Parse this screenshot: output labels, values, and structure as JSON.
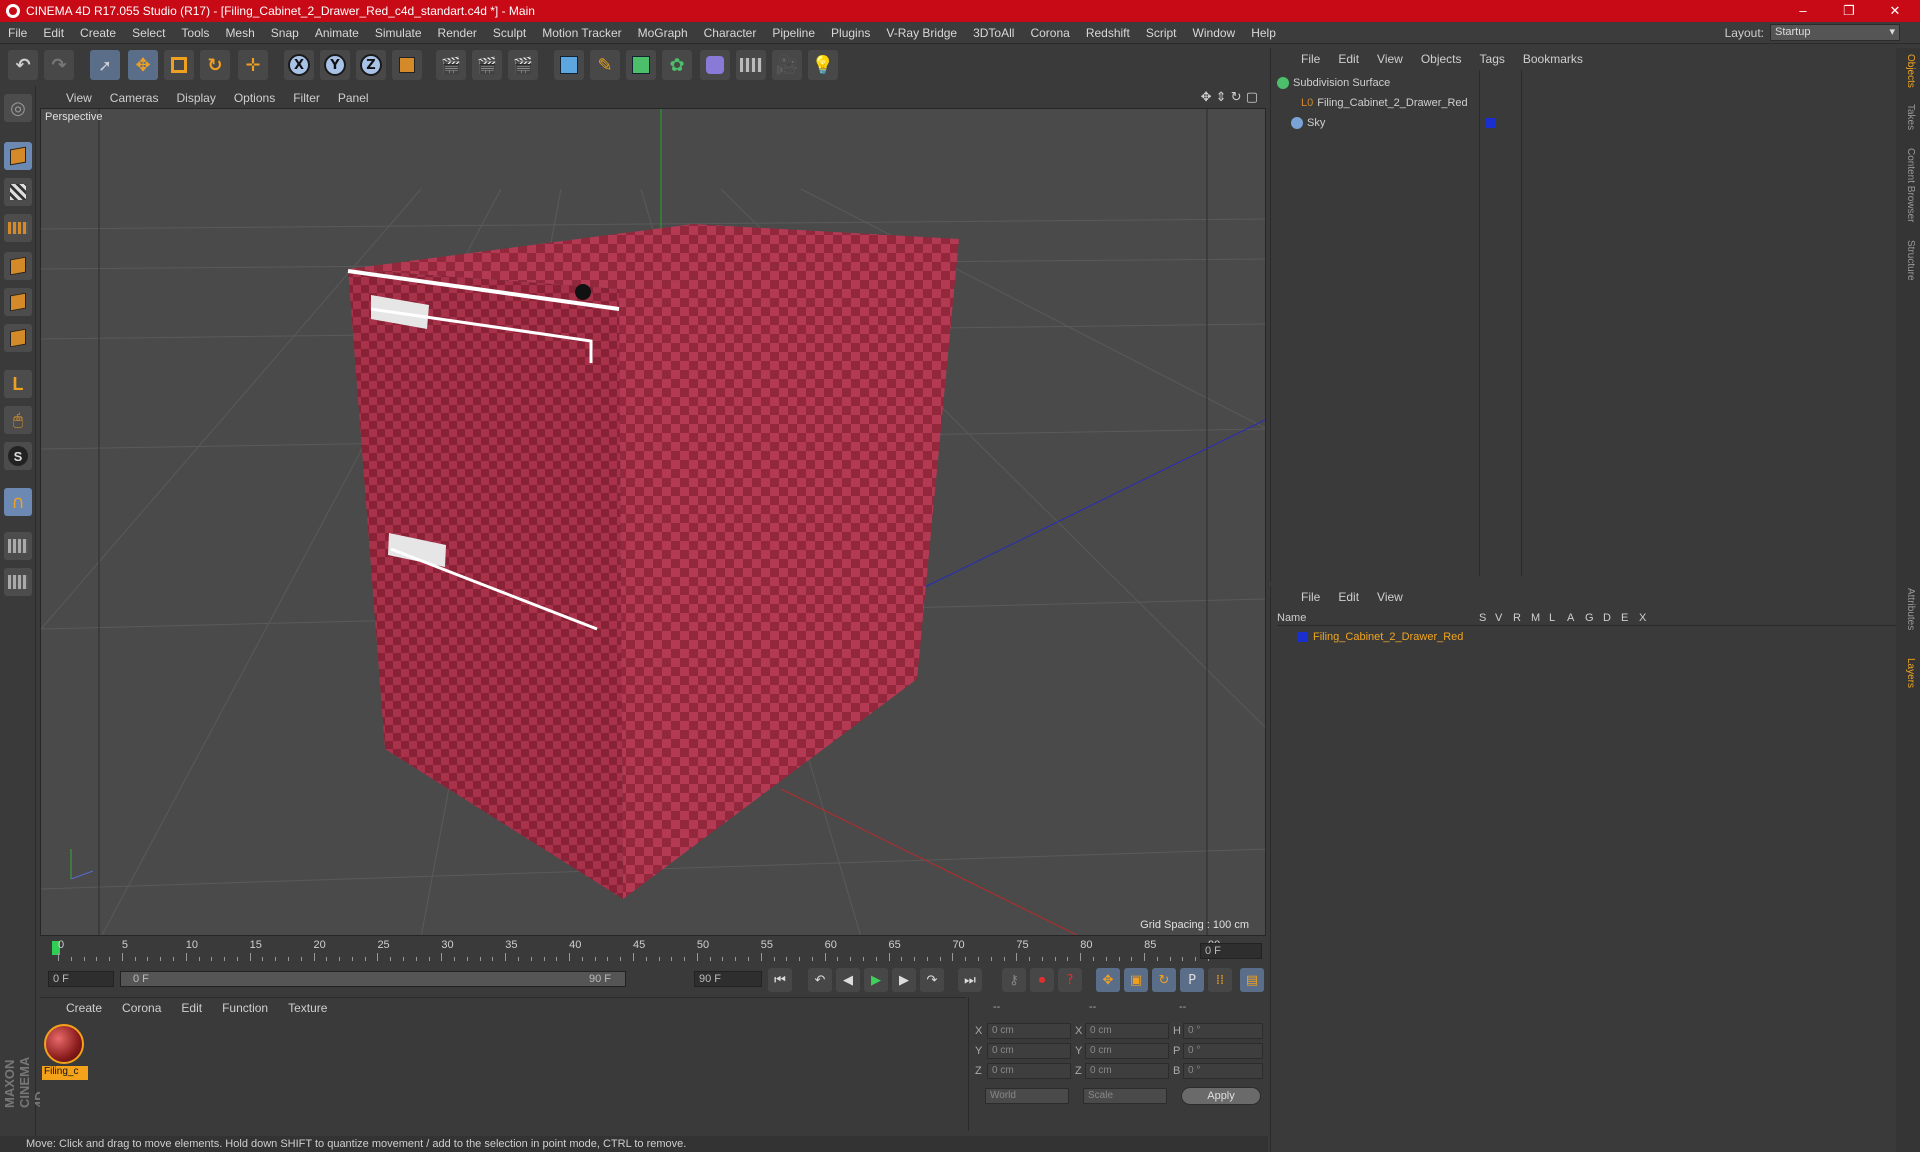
{
  "window": {
    "title": "CINEMA 4D R17.055 Studio (R17) - [Filing_Cabinet_2_Drawer_Red_c4d_standart.c4d *] - Main",
    "controls": [
      "–",
      "❐",
      "✕"
    ]
  },
  "menubar": {
    "items": [
      "File",
      "Edit",
      "Create",
      "Select",
      "Tools",
      "Mesh",
      "Snap",
      "Animate",
      "Simulate",
      "Render",
      "Sculpt",
      "Motion Tracker",
      "MoGraph",
      "Character",
      "Pipeline",
      "Plugins",
      "V-Ray Bridge",
      "3DToAll",
      "Corona",
      "Redshift",
      "Script",
      "Window",
      "Help"
    ],
    "layout_label": "Layout:",
    "layout_value": "Startup"
  },
  "toolbar": {
    "axis_x": "X",
    "axis_y": "Y",
    "axis_z": "Z"
  },
  "viewport": {
    "menu": [
      "View",
      "Cameras",
      "Display",
      "Options",
      "Filter",
      "Panel"
    ],
    "label": "Perspective",
    "grid_spacing": "Grid Spacing : 100 cm",
    "colors": {
      "model": "#a8324a",
      "background": "#4a4a4a"
    }
  },
  "timeline": {
    "ticks": [
      "0",
      "5",
      "10",
      "15",
      "20",
      "25",
      "30",
      "35",
      "40",
      "45",
      "50",
      "55",
      "60",
      "65",
      "70",
      "75",
      "80",
      "85",
      "90"
    ],
    "current_frame": "0 F"
  },
  "transport": {
    "start": "0 F",
    "slider_start": "0 F",
    "slider_end": "90 F",
    "end": "90 F"
  },
  "material_manager": {
    "menu": [
      "Create",
      "Corona",
      "Edit",
      "Function",
      "Texture"
    ],
    "material_name": "Filing_c"
  },
  "coordinates": {
    "headers": [
      "--",
      "--",
      "--"
    ],
    "rows": [
      {
        "l1": "X",
        "v1": "0 cm",
        "l2": "X",
        "v2": "0 cm",
        "l3": "H",
        "v3": "0 °"
      },
      {
        "l1": "Y",
        "v1": "0 cm",
        "l2": "Y",
        "v2": "0 cm",
        "l3": "P",
        "v3": "0 °"
      },
      {
        "l1": "Z",
        "v1": "0 cm",
        "l2": "Z",
        "v2": "0 cm",
        "l3": "B",
        "v3": "0 °"
      }
    ],
    "mode1": "World",
    "mode2": "Scale",
    "apply": "Apply"
  },
  "status": "Move: Click and drag to move elements. Hold down SHIFT to quantize movement / add to the selection in point mode, CTRL to remove.",
  "object_manager": {
    "menu": [
      "File",
      "Edit",
      "View",
      "Objects",
      "Tags",
      "Bookmarks"
    ],
    "objects": [
      "Subdivision Surface",
      "Filing_Cabinet_2_Drawer_Red",
      "Sky"
    ]
  },
  "layer_manager": {
    "menu": [
      "File",
      "Edit",
      "View"
    ],
    "name_header": "Name",
    "columns": [
      "S",
      "V",
      "R",
      "M",
      "L",
      "A",
      "G",
      "D",
      "E",
      "X"
    ],
    "layer_name": "Filing_Cabinet_2_Drawer_Red",
    "layer_color": "#1a2fd0"
  },
  "side_tabs": [
    "Objects",
    "Takes",
    "Content Browser",
    "Structure",
    "Attributes",
    "Layers"
  ],
  "brand": "MAXON CINEMA 4D"
}
